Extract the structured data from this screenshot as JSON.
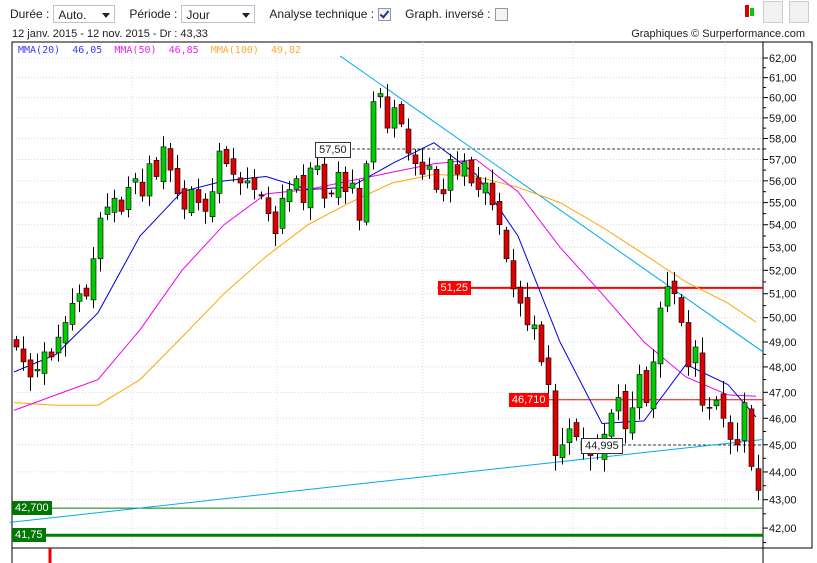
{
  "toolbar": {
    "duree_label": "Durée :",
    "duree_value": "Auto.",
    "periode_label": "Période :",
    "periode_value": "Jour",
    "analyse_label": "Analyse technique :",
    "analyse_checked": true,
    "inverse_label": "Graph. inversé :",
    "inverse_checked": false,
    "icons": [
      "candlestick-chart-icon",
      "line-chart-icon",
      "bar-chart-icon"
    ]
  },
  "info": {
    "range": "12 janv. 2015 - 12 nov. 2015 - Dr : 43,33",
    "copyright": "Graphiques © Surperformance.com"
  },
  "legend": {
    "ma20_label": "MMA(20)",
    "ma20_value": "46,05",
    "ma50_label": "MMA(50)",
    "ma50_value": "46,85",
    "ma100_label": "MMA(100)",
    "ma100_value": "49,82"
  },
  "colors": {
    "up": "#00cc00",
    "down": "#dd0000",
    "ma20": "#0000dd",
    "ma50": "#ee00ee",
    "ma100": "#ffa500",
    "trend": "#00aaee",
    "resist": "#ff0000",
    "support": "#008000"
  },
  "chart_data": {
    "type": "candlestick",
    "yscale": "log",
    "ylim": [
      41.5,
      62.5
    ],
    "yticks": [
      "62,00",
      "61,00",
      "60,00",
      "59,00",
      "58,00",
      "57,00",
      "56,00",
      "55,00",
      "54,00",
      "53,00",
      "52,00",
      "51,00",
      "50,00",
      "49,00",
      "48,00",
      "47,00",
      "46,00",
      "45,00",
      "44,00",
      "43,00",
      "42,00"
    ],
    "closes": [
      48.8,
      48.2,
      47.6,
      47.9,
      48.6,
      48.4,
      49.2,
      49.8,
      50.6,
      51.0,
      50.9,
      52.5,
      54.3,
      54.8,
      55.2,
      54.6,
      55.7,
      56.1,
      55.3,
      56.8,
      56.2,
      57.6,
      56.5,
      55.4,
      54.7,
      55.6,
      55.0,
      54.6,
      55.5,
      57.4,
      56.8,
      56.3,
      55.9,
      56.0,
      55.6,
      55.3,
      54.5,
      53.6,
      55.2,
      55.6,
      56.1,
      55.0,
      56.6,
      56.7,
      55.2,
      55.4,
      56.4,
      55.5,
      55.9,
      54.2,
      56.8,
      59.8,
      60.2,
      58.5,
      59.5,
      58.7,
      57.3,
      56.8,
      56.3,
      56.7,
      55.6,
      55.4,
      57.0,
      56.3,
      56.9,
      55.9,
      55.6,
      55.9,
      54.9,
      54.0,
      52.5,
      51.2,
      50.6,
      49.7,
      49.7,
      48.2,
      47.3,
      44.6,
      45.0,
      45.6,
      45.3,
      44.8,
      44.6,
      44.7,
      45.4,
      46.2,
      46.8,
      45.6,
      46.4,
      47.7,
      46.6,
      48.2,
      50.4,
      51.3,
      51.0,
      49.8,
      48.0,
      48.8,
      46.5,
      46.4,
      46.7,
      46.0,
      45.2,
      45.0,
      46.6,
      44.2,
      43.33
    ],
    "ma_index": [
      0,
      6,
      12,
      18,
      24,
      30,
      36,
      42,
      48,
      54,
      60,
      66,
      72,
      78,
      84,
      90,
      96,
      102,
      106
    ],
    "ma20": [
      47.8,
      48.5,
      50.2,
      53.5,
      55.5,
      56.0,
      56.2,
      55.6,
      55.7,
      56.8,
      57.8,
      56.3,
      53.5,
      49.0,
      45.8,
      45.9,
      48.1,
      47.3,
      46.05
    ],
    "ma50": [
      46.3,
      46.9,
      47.5,
      49.5,
      52.0,
      54.0,
      55.4,
      55.6,
      56.0,
      56.4,
      56.8,
      57.0,
      55.5,
      53.0,
      51.0,
      49.0,
      47.6,
      46.9,
      46.85
    ],
    "ma100": [
      46.6,
      46.5,
      46.5,
      47.5,
      49.2,
      51.0,
      52.6,
      54.0,
      55.0,
      55.9,
      56.3,
      56.2,
      55.7,
      55.0,
      53.9,
      52.7,
      51.5,
      50.6,
      49.82
    ],
    "trendlines": [
      {
        "name": "descending",
        "from": [
          46.6,
          62.1
        ],
        "to": [
          107,
          48.6
        ]
      },
      {
        "name": "ascending",
        "from": [
          -0.6,
          42.2
        ],
        "to": [
          107,
          45.2
        ]
      }
    ],
    "levels": [
      {
        "label": "57,50",
        "value": 57.5,
        "kind": "dashed",
        "start": 43.3
      },
      {
        "label": "51,25",
        "value": 51.25,
        "kind": "resist-thick",
        "start": 60.5
      },
      {
        "label": "46,710",
        "value": 46.71,
        "kind": "resist",
        "start": 70.7
      },
      {
        "label": "44,995",
        "value": 44.995,
        "kind": "dashed",
        "start": 81.3
      },
      {
        "label": "42,700",
        "value": 42.7,
        "kind": "support",
        "start": -0.6
      },
      {
        "label": "41,75",
        "value": 41.75,
        "kind": "support-thick",
        "start": -0.6
      }
    ]
  }
}
